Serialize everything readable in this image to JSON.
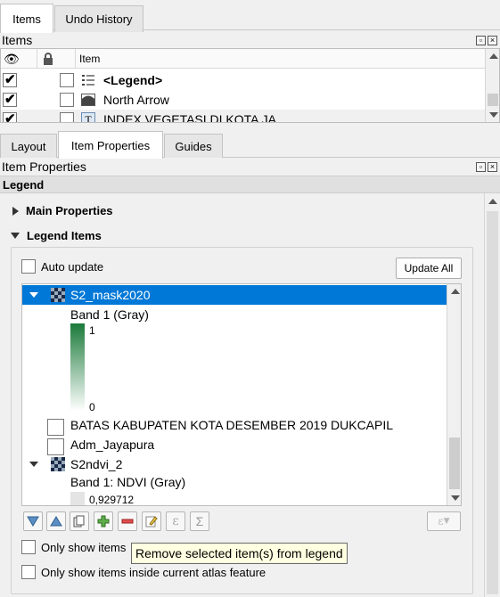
{
  "top_tabs": [
    "Items",
    "Undo History"
  ],
  "items_panel": {
    "title": "Items",
    "header_item": "Item",
    "rows": [
      {
        "visible": true,
        "locked": false,
        "icon": "legend-icon",
        "label": "<Legend>",
        "bold": true
      },
      {
        "visible": true,
        "locked": false,
        "icon": "north-arrow-icon",
        "label": "North Arrow",
        "bold": false
      },
      {
        "visible": true,
        "locked": false,
        "icon": "text-icon",
        "label": "INDEX VEGETASI DI KOTA JA...",
        "bold": false
      }
    ]
  },
  "mid_tabs": [
    "Layout",
    "Item Properties",
    "Guides"
  ],
  "props_panel": {
    "title": "Item Properties",
    "subtitle": "Legend",
    "main_properties": "Main Properties",
    "legend_items": "Legend Items",
    "auto_update": "Auto update",
    "update_all": "Update All",
    "tree": {
      "layer1": "S2_mask2020",
      "band1": "Band 1 (Gray)",
      "ramp_max": "1",
      "ramp_min": "0",
      "layer2": "BATAS KABUPATEN KOTA DESEMBER 2019 DUKCAPIL",
      "layer3": "Adm_Jayapura",
      "layer4": "S2ndvi_2",
      "band4": "Band 1: NDVI (Gray)",
      "ndvi_max": "0,929712"
    },
    "tool_glyphs": {
      "expression": "ε",
      "sum": "Σ",
      "expression_disabled": "ε"
    },
    "only_show_items": "Only show items",
    "only_show_atlas": "Only show items inside current atlas feature",
    "tooltip": "Remove selected item(s) from legend"
  },
  "colors": {
    "selection": "#0078d7",
    "ramp_top": "#1b7a3a",
    "tooltip_bg": "#ffffe1"
  }
}
